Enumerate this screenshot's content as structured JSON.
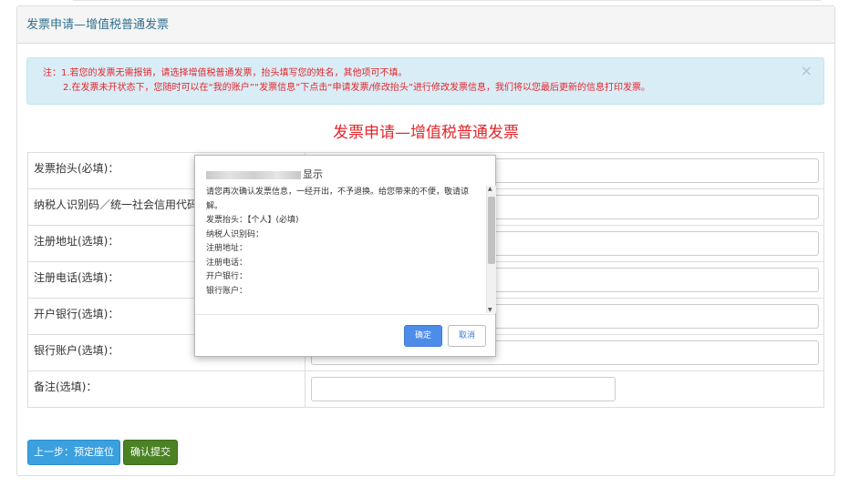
{
  "panel": {
    "title": "发票申请—增值税普通发票"
  },
  "notice": {
    "line1": "注：1.若您的发票无需报销，请选择增值税普通发票，抬头填写您的姓名，其他项可不填。",
    "line2": "2.在发票未开状态下，您随时可以在“我的账户”“发票信息”下点击“申请发票/修改抬头”进行修改发票信息，我们将以您最后更新的信息打印发票。",
    "close": "×"
  },
  "form": {
    "title": "发票申请—增值税普通发票",
    "rows": [
      {
        "label": "发票抬头(必填)："
      },
      {
        "label": "纳税人识别码／统一社会信用代码"
      },
      {
        "label": "注册地址(选填)："
      },
      {
        "label": "注册电话(选填)："
      },
      {
        "label": "开户银行(选填)："
      },
      {
        "label": "银行账户(选填)："
      },
      {
        "label": "备注(选填)："
      }
    ]
  },
  "buttons": {
    "prev": "上一步：预定座位",
    "confirm": "确认提交"
  },
  "dialog": {
    "title_suffix": "显示",
    "message": "请您再次确认发票信息，一经开出，不予退换。给您带来的不便，敬请谅解。",
    "fields": [
      "发票抬头：【个人】(必填)",
      "纳税人识别码：",
      "注册地址：",
      "注册电话：",
      "开户银行：",
      "银行账户："
    ],
    "ok": "确定",
    "cancel": "取消"
  },
  "colors": {
    "heading": "#31708f",
    "alert_bg": "#d9edf7",
    "alert_text": "#e4262b",
    "primary": "#3aa0de",
    "success": "#4a8224",
    "dialog_ok": "#4d8ce9"
  }
}
